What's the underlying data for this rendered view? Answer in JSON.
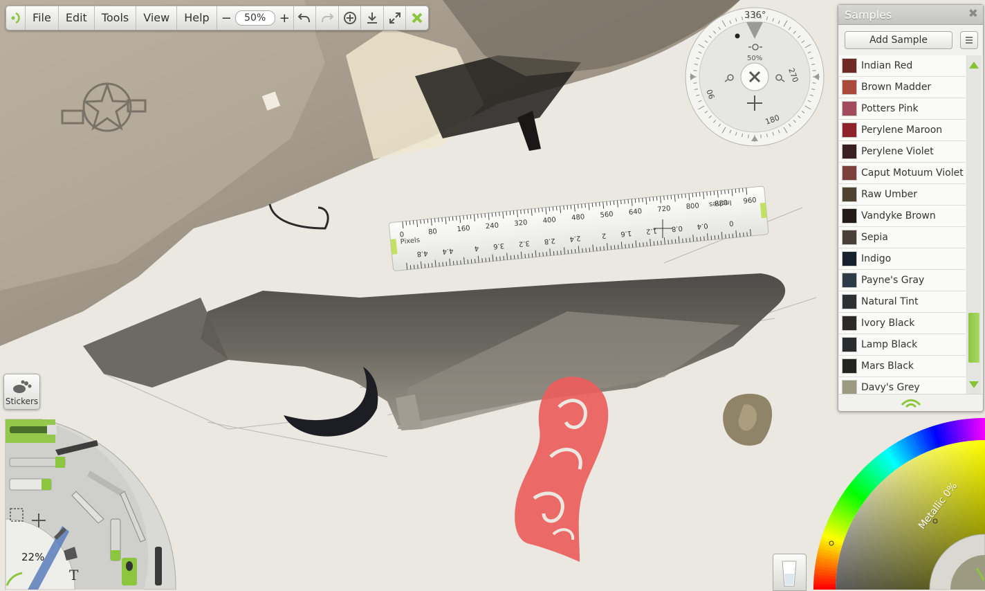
{
  "toolbar": {
    "menus": [
      "File",
      "Edit",
      "Tools",
      "View",
      "Help"
    ],
    "zoom_minus": "−",
    "zoom_value": "50%",
    "zoom_plus": "+"
  },
  "navigator": {
    "angle": "336°",
    "zoom": "50%",
    "tick_270": "270",
    "tick_180": "180",
    "tick_90": "90"
  },
  "ruler": {
    "pixels_label": "Pixels",
    "inches_label": "Inches",
    "pixel_ticks": [
      "0",
      "80",
      "160",
      "240",
      "320",
      "400",
      "480",
      "560",
      "640",
      "720",
      "800",
      "880",
      "960"
    ],
    "inch_ticks": [
      "4.8",
      "4.4",
      "4",
      "3.6",
      "3.2",
      "2.8",
      "2.4",
      "2",
      "1.6",
      "1.2",
      "0.8",
      "0.4",
      "0"
    ]
  },
  "samples": {
    "title": "Samples",
    "add_label": "Add Sample",
    "items": [
      {
        "name": "Indian Red",
        "color": "#6e2a22"
      },
      {
        "name": "Brown Madder",
        "color": "#a84b3a"
      },
      {
        "name": "Potters Pink",
        "color": "#a14b5c"
      },
      {
        "name": "Perylene Maroon",
        "color": "#8e2329"
      },
      {
        "name": "Perylene Violet",
        "color": "#3a1f22"
      },
      {
        "name": "Caput Motuum Violet",
        "color": "#7a4039"
      },
      {
        "name": "Raw Umber",
        "color": "#4e4231"
      },
      {
        "name": "Vandyke Brown",
        "color": "#241a17"
      },
      {
        "name": "Sepia",
        "color": "#4a3f36"
      },
      {
        "name": "Indigo",
        "color": "#15202c"
      },
      {
        "name": "Payne's Gray",
        "color": "#2d3b47"
      },
      {
        "name": "Natural Tint",
        "color": "#2e2f32"
      },
      {
        "name": "Ivory Black",
        "color": "#2c2a27"
      },
      {
        "name": "Lamp Black",
        "color": "#2a2b2d"
      },
      {
        "name": "Mars Black",
        "color": "#232322"
      },
      {
        "name": "Davy's Grey",
        "color": "#9d9a82"
      }
    ]
  },
  "stickers": {
    "label": "Stickers"
  },
  "tools": {
    "size_pct": "22%",
    "text_tool": "T"
  },
  "color_picker": {
    "metallic_label": "Metallic 0%"
  },
  "colors": {
    "accent": "#8cc63f",
    "curve": "#ea5d5c"
  }
}
